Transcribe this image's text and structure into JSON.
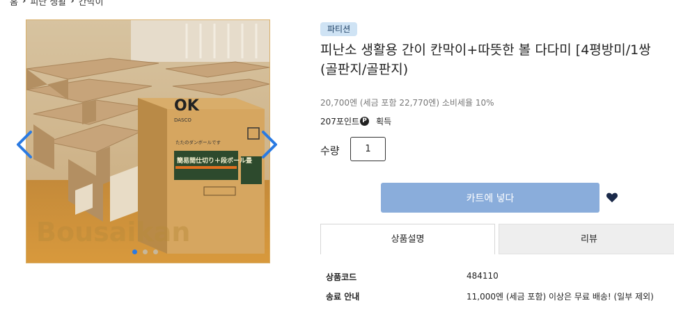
{
  "breadcrumb": {
    "items": [
      "홈",
      "피난 생활",
      "칸막이"
    ]
  },
  "gallery": {
    "watermark": "Bousaikan",
    "box_brand": "OK",
    "box_sub": "DASCO",
    "box_label": "簡易間仕切り＋段ボール畳",
    "box_side_label": "簡易間仕切り＋段ボール畳",
    "box_caption": "たたのダンボールです",
    "slide_count": 3,
    "active_slide": 1
  },
  "product": {
    "category_badge": "파티션",
    "title_line1": "피난소 생활용 간이 칸막이+따뜻한 볼 다다미 [4평방미/1쌍",
    "title_line2": "(골판지/골판지)",
    "price_text": "20,700엔 (세금 포함 22,770엔) 소비세율 10%",
    "points_amount": "207포인트",
    "points_icon_letter": "P",
    "points_suffix": "획득",
    "quantity_label": "수량",
    "quantity_value": "1",
    "add_to_cart_label": "카트에 넣다"
  },
  "tabs": {
    "description": "상품설명",
    "review": "리뷰"
  },
  "specs": [
    {
      "key": "상품코드",
      "value": "484110"
    },
    {
      "key": "송료 안내",
      "value": "11,000엔 (세금 포함) 이상은 무료 배송! (일부 제외)"
    }
  ],
  "colors": {
    "accent": "#2a7ae2",
    "badge_bg": "#cfe3f4",
    "cart_button": "#8aaddb",
    "heart": "#1b2a4a"
  }
}
